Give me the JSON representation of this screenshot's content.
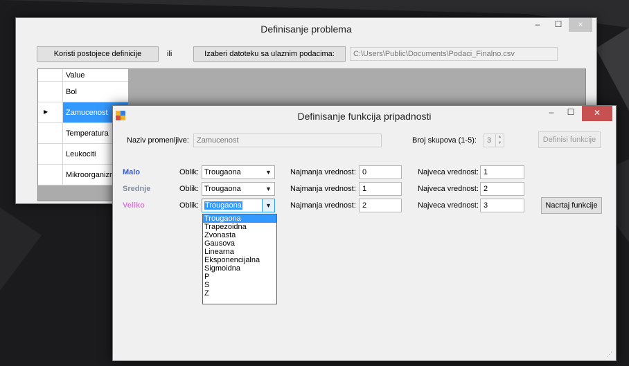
{
  "main_window": {
    "title": "Definisanje problema",
    "min_glyph": "–",
    "max_glyph": "☐",
    "close_glyph": "×",
    "use_existing_button": "Koristi postojece definicije",
    "or_label": "ili",
    "choose_file_button": "Izaberi datoteku sa ulaznim podacima:",
    "file_path": "C:\\Users\\Public\\Documents\\Podaci_Finalno.csv",
    "grid": {
      "column_header": "Value",
      "selected_marker": "▶",
      "rows": [
        "Bol",
        "Zamucenost",
        "Temperatura",
        "Leukociti",
        "Mikroorganizmi"
      ]
    }
  },
  "dialog": {
    "title": "Definisanje funkcija pripadnosti",
    "min_glyph": "–",
    "max_glyph": "☐",
    "close_glyph": "✕",
    "var_name_label": "Naziv promenljive:",
    "var_name_value": "Zamucenost",
    "set_count_label": "Broj skupova (1-5):",
    "set_count_value": "3",
    "define_button": "Definisi funkcije",
    "draw_button": "Nacrtaj funkcije",
    "shape_label": "Oblik:",
    "min_label": "Najmanja vrednost:",
    "max_label": "Najveca vrednost:",
    "sets": [
      {
        "name": "Malo",
        "color": "#3b5cc4",
        "shape": "Trougaona",
        "min": "0",
        "max": "1"
      },
      {
        "name": "Srednje",
        "color": "#7f8c9c",
        "shape": "Trougaona",
        "min": "1",
        "max": "2"
      },
      {
        "name": "Veliko",
        "color": "#e07ae0",
        "shape": "Trougaona",
        "min": "2",
        "max": "3"
      }
    ],
    "dropdown_options": [
      "Trougaona",
      "Trapezoidna",
      "Zvonasta",
      "Gausova",
      "Linearna",
      "Eksponencijalna",
      "Sigmoidna",
      "P",
      "S",
      "Z"
    ]
  }
}
